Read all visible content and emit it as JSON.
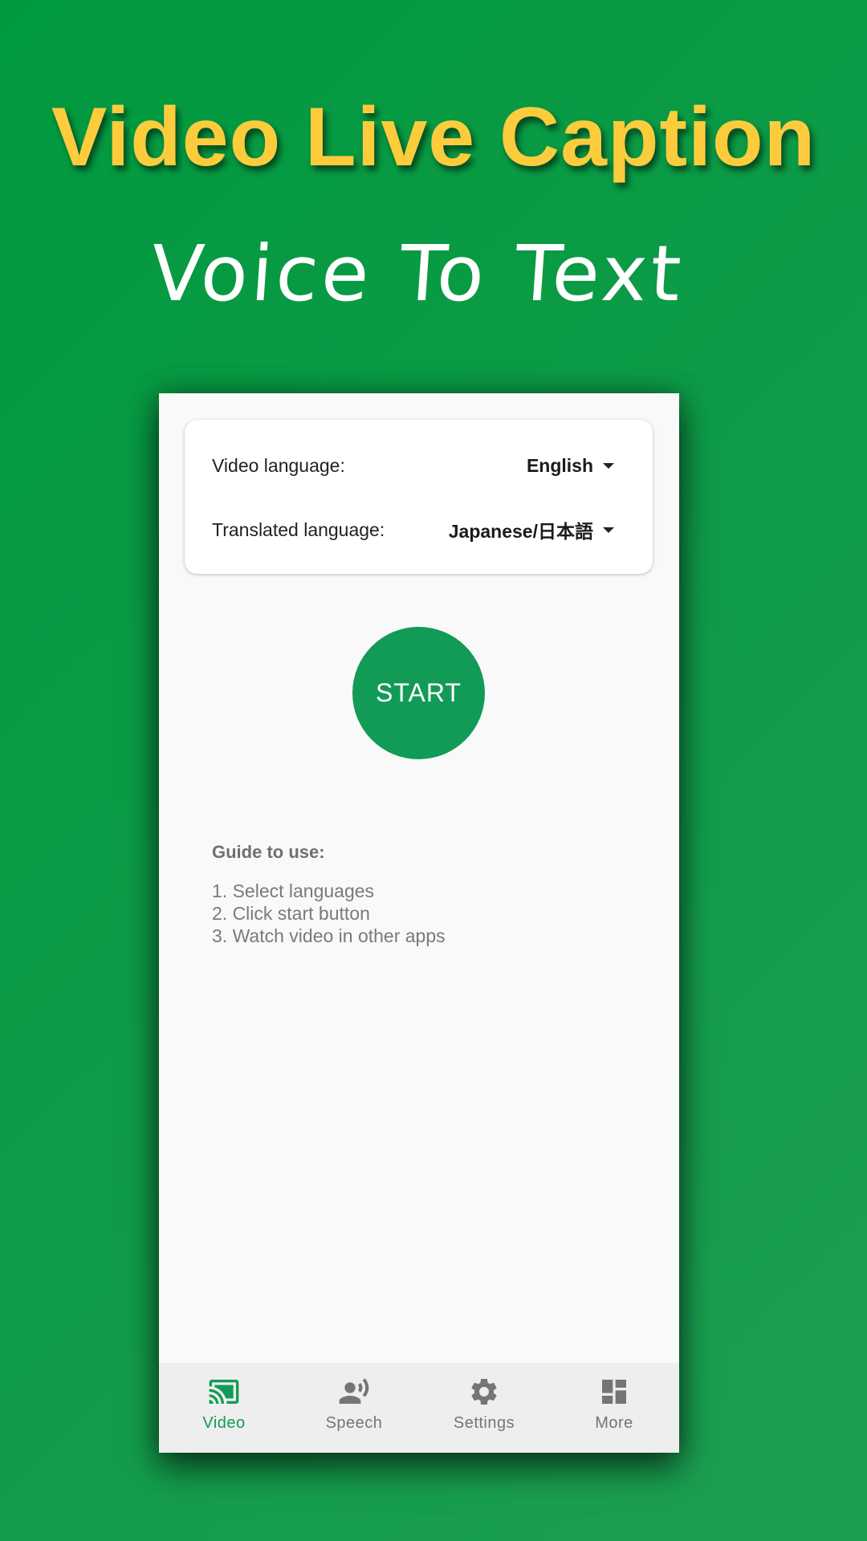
{
  "promo": {
    "headline": "Video Live Caption",
    "subhead": "Voice To Text"
  },
  "language_card": {
    "video_language_label": "Video language:",
    "video_language_value": "English",
    "translated_language_label": "Translated language:",
    "translated_language_value": "Japanese/日本語"
  },
  "start_button": {
    "label": "START"
  },
  "guide": {
    "title": "Guide to use:",
    "steps": [
      "1. Select languages",
      "2. Click start button",
      "3. Watch video in other apps"
    ]
  },
  "bottom_nav": {
    "items": [
      {
        "label": "Video",
        "icon": "cast-icon",
        "active": true
      },
      {
        "label": "Speech",
        "icon": "voice-person-icon",
        "active": false
      },
      {
        "label": "Settings",
        "icon": "gear-icon",
        "active": false
      },
      {
        "label": "More",
        "icon": "dashboard-icon",
        "active": false
      }
    ]
  },
  "colors": {
    "accent": "#129b57",
    "headline": "#fccc3d",
    "background": "#0f9b48"
  }
}
